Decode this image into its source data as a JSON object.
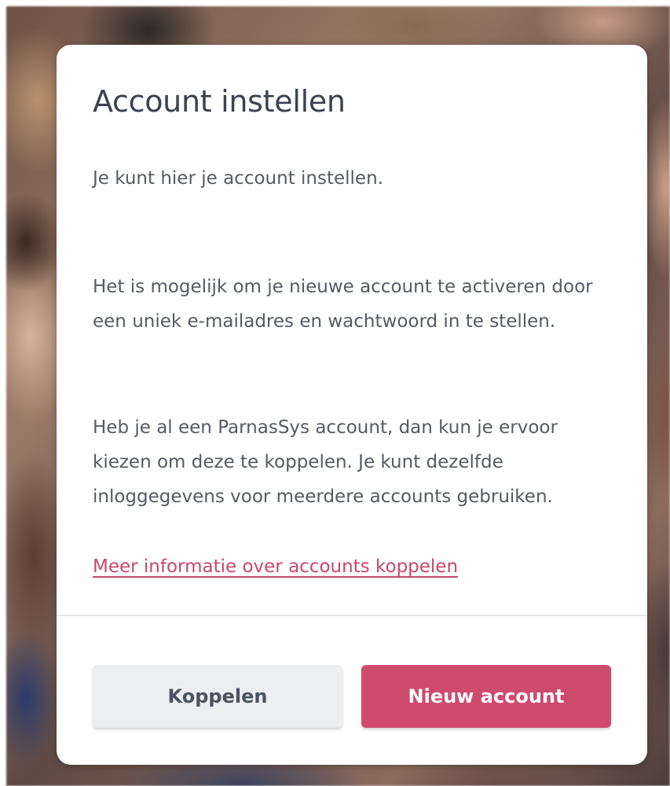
{
  "dialog": {
    "title": "Account instellen",
    "paragraphs": [
      "Je kunt hier je account instellen.",
      "Het is mogelijk om je nieuwe account te activeren door een uniek e-mailadres en wachtwoord in te stellen.",
      "Heb je al een ParnasSys account, dan kun je ervoor kiezen om deze te koppelen. Je kunt dezelfde inloggegevens voor meerdere accounts gebruiken."
    ],
    "link_text": "Meer informatie over accounts koppelen",
    "buttons": {
      "secondary_label": "Koppelen",
      "primary_label": "Nieuw account"
    }
  },
  "colors": {
    "primary": "#cf4b6e",
    "link": "#c9486c",
    "secondary_button": "#eceef2",
    "title_text": "#3b4250",
    "body_text": "#555b63"
  }
}
